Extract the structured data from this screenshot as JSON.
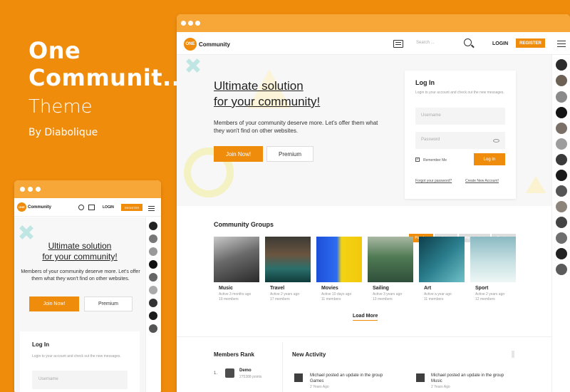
{
  "promo": {
    "title_line1": "One",
    "title_line2": "Communit..",
    "subtitle": "Theme",
    "byline": "By Diabolique"
  },
  "colors": {
    "accent": "#f08c0c",
    "bar": "#f7a738",
    "bg": "#f08c0c"
  },
  "site": {
    "logo_text": "ONE",
    "brand": "Community",
    "search_placeholder": "Search ...",
    "login": "LOGIN",
    "register": "REGISTER",
    "hero_title_1": "Ultimate solution",
    "hero_title_2": "for your community!",
    "hero_text": "Members of your community deserve more. Let's offer them what they won't find on other websites.",
    "join_btn": "Join Now!",
    "premium_btn": "Premium"
  },
  "login": {
    "title": "Log In",
    "desc": "Login to your account and check out the new messages.",
    "username_placeholder": "Username",
    "password_placeholder": "Password",
    "remember": "Remember Me",
    "submit": "Log In",
    "forgot": "Forgot your password?",
    "create": "Create New Account!"
  },
  "groups": {
    "title": "Community Groups",
    "tabs": [
      "Popular",
      "Active",
      "Alphabetical",
      "Random"
    ],
    "items": [
      {
        "name": "Music",
        "active": "Active 3 months ago",
        "members": "19 members"
      },
      {
        "name": "Travel",
        "active": "Active 2 years ago",
        "members": "17 members"
      },
      {
        "name": "Movies",
        "active": "Active 10 days ago",
        "members": "11 members"
      },
      {
        "name": "Sailing",
        "active": "Active 3 years ago",
        "members": "13 members"
      },
      {
        "name": "Art",
        "active": "Active a year ago",
        "members": "11 members"
      },
      {
        "name": "Sport",
        "active": "Active 2 years ago",
        "members": "12 members"
      }
    ],
    "load_more": "Load More"
  },
  "members_rank": {
    "title": "Members Rank",
    "first_rank": "1.",
    "first_name": "Demo",
    "first_points": "275388 points"
  },
  "activity": {
    "title": "New Activity",
    "items": [
      {
        "line1": "Michael posted an update in the group",
        "line2": "Games",
        "time": "2 Years Ago"
      },
      {
        "line1": "Michael posted an update in the group",
        "line2": "Music",
        "time": "2 Years Ago"
      }
    ]
  },
  "mobile": {
    "hero_title_1": "Ultimate solution",
    "hero_title_2": "for your community!",
    "hero_text": "Members of your community deserve more. Let's offer them what they won't find on other websites.",
    "join_btn": "Join Now!",
    "premium_btn": "Premium",
    "login_title": "Log In",
    "login_desc": "Login to your account and check out the new messages.",
    "username_placeholder": "Username"
  }
}
